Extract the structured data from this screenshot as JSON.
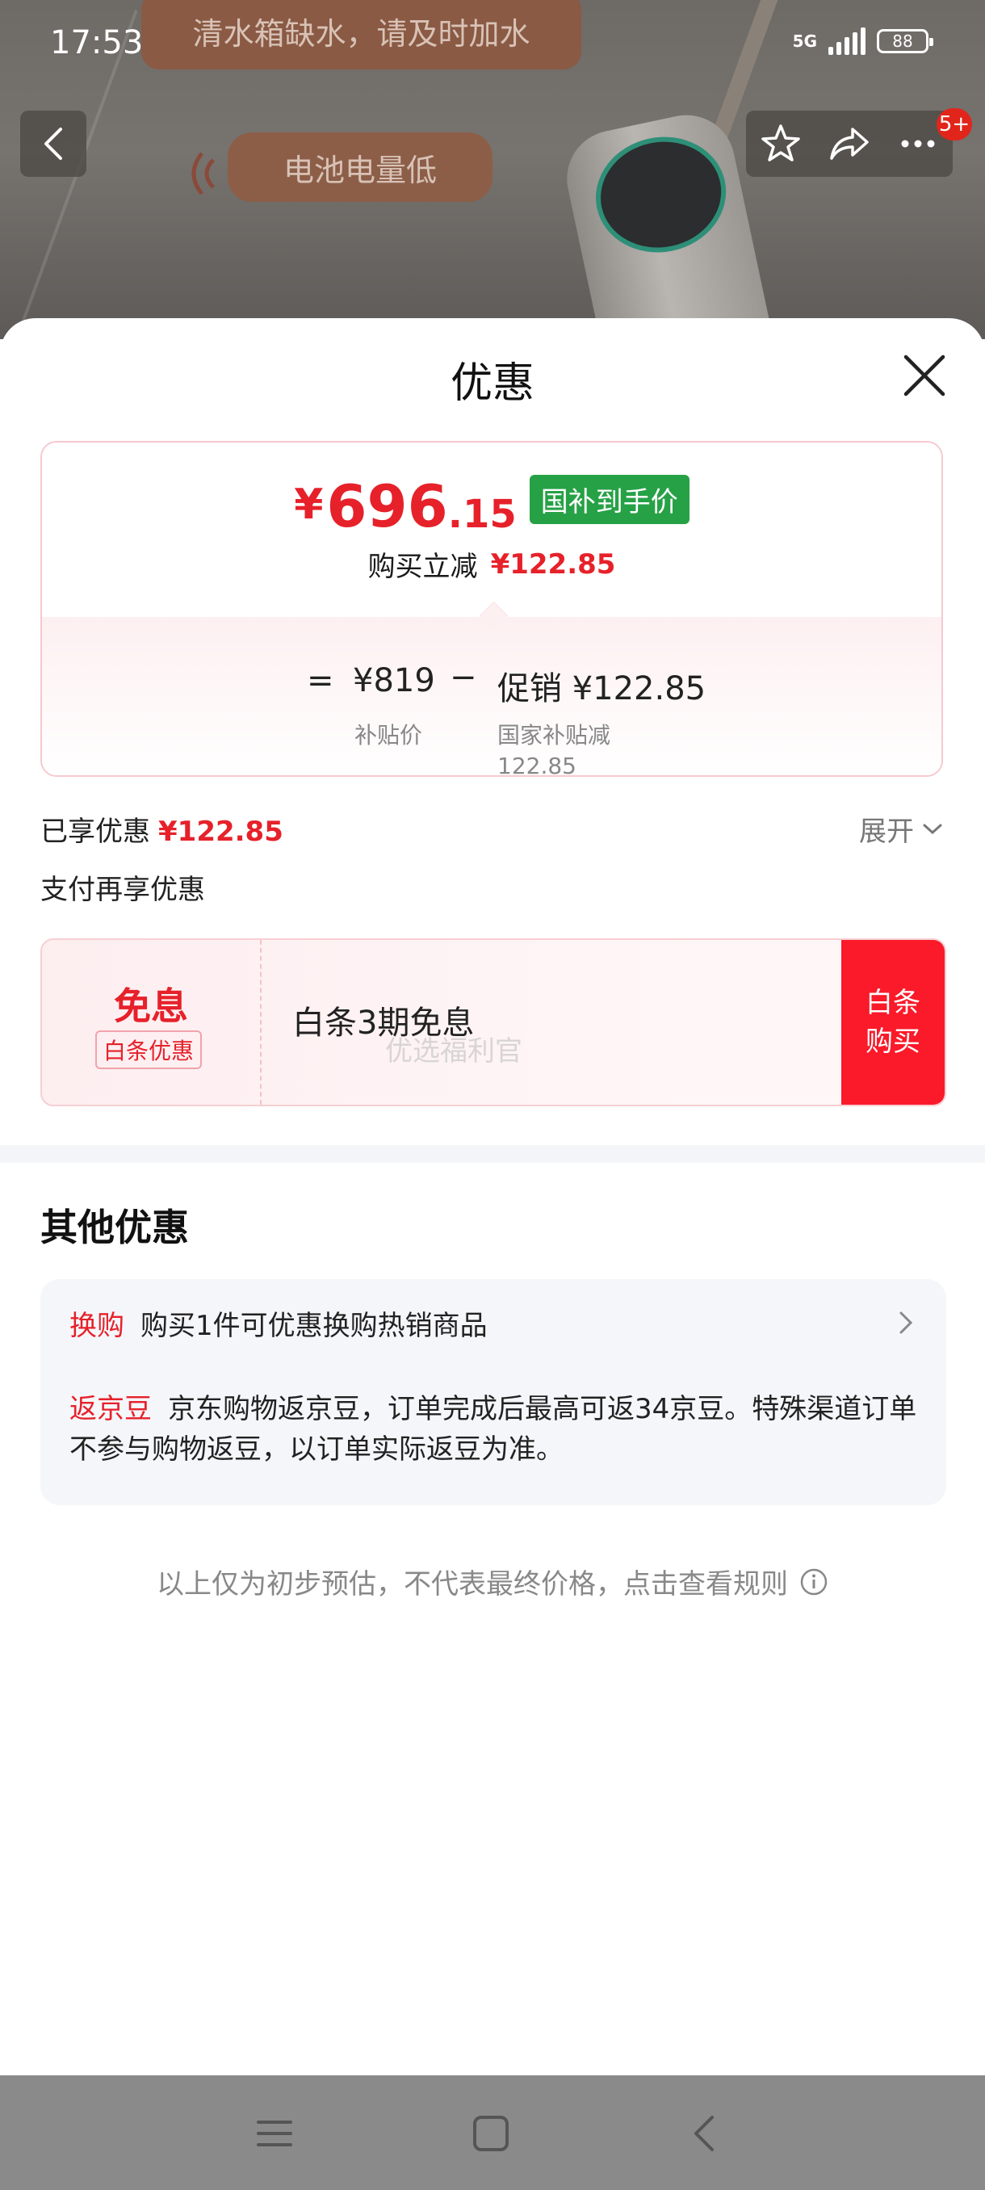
{
  "status_bar": {
    "time": "17:53",
    "network": "5G",
    "battery": "88"
  },
  "background": {
    "banner_text_1": "清水箱缺水，请及时加水",
    "banner_text_2": "电池电量低"
  },
  "top_nav": {
    "badge": "5+"
  },
  "sheet": {
    "title": "优惠",
    "price": {
      "currency": "¥",
      "integer": "696",
      "decimal": ".15",
      "tag": "国补到手价",
      "reduce_label": "购买立减",
      "reduce_value": "¥122.85"
    },
    "formula": {
      "equals": "=",
      "base_value": "¥819",
      "base_label": "补贴价",
      "minus": "−",
      "promo_value": "促销 ¥122.85",
      "promo_label_1": "国家补贴减",
      "promo_label_2": "122.85"
    },
    "enjoyed_label": "已享优惠",
    "enjoyed_value": "¥122.85",
    "expand_label": "展开",
    "pay_more_label": "支付再享优惠",
    "coupon": {
      "title": "免息",
      "tag": "白条优惠",
      "description": "白条3期免息",
      "watermark": "优选福利官",
      "button_line1": "白条",
      "button_line2": "购买"
    },
    "other_title": "其他优惠",
    "other": {
      "row1_tag": "换购",
      "row1_text": "购买1件可优惠换购热销商品",
      "row2_tag": "返京豆",
      "row2_text": "京东购物返京豆，订单完成后最高可返34京豆。特殊渠道订单不参与购物返豆，以订单实际返豆为准。"
    },
    "footnote": "以上仅为初步预估，不代表最终价格，点击查看规则"
  },
  "colors": {
    "accent_red": "#e6212a",
    "green_tag": "#27a146",
    "button_red": "#fa1a2a"
  }
}
